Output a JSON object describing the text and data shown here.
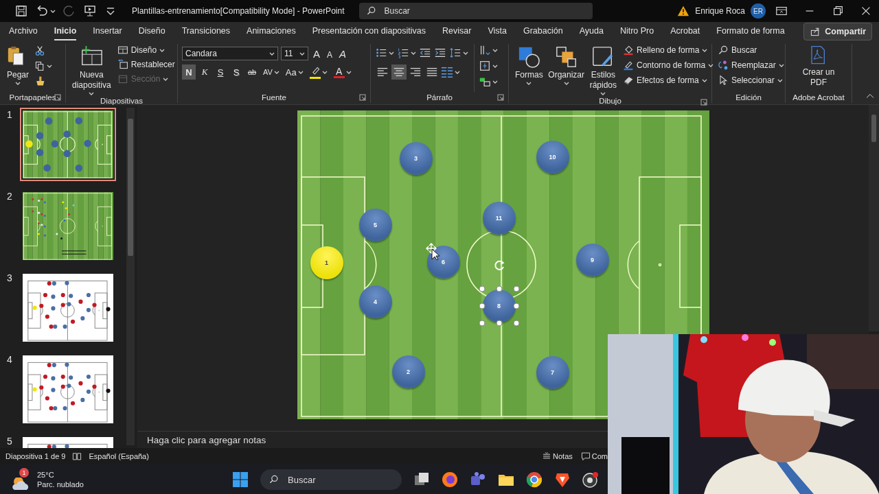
{
  "window": {
    "title": "Plantillas-entrenamiento[Compatibility Mode]  -  PowerPoint",
    "search": {
      "placeholder": "Buscar"
    },
    "user_name": "Enrique Roca",
    "avatar_initials": "ER"
  },
  "tabs": [
    {
      "label": "Archivo",
      "selected": false
    },
    {
      "label": "Inicio",
      "selected": true
    },
    {
      "label": "Insertar",
      "selected": false
    },
    {
      "label": "Diseño",
      "selected": false
    },
    {
      "label": "Transiciones",
      "selected": false
    },
    {
      "label": "Animaciones",
      "selected": false
    },
    {
      "label": "Presentación con diapositivas",
      "selected": false
    },
    {
      "label": "Revisar",
      "selected": false
    },
    {
      "label": "Vista",
      "selected": false
    },
    {
      "label": "Grabación",
      "selected": false
    },
    {
      "label": "Ayuda",
      "selected": false
    },
    {
      "label": "Nitro Pro",
      "selected": false
    },
    {
      "label": "Acrobat",
      "selected": false
    },
    {
      "label": "Formato de forma",
      "selected": false
    }
  ],
  "share_button": "Compartir",
  "ribbon": {
    "clipboard": {
      "label": "Portapapeles",
      "paste": "Pegar"
    },
    "slides": {
      "label": "Diapositivas",
      "new_slide": "Nueva diapositiva",
      "items": [
        {
          "label": "Diseño",
          "disabled": false
        },
        {
          "label": "Restablecer",
          "disabled": false
        },
        {
          "label": "Sección",
          "disabled": true
        }
      ]
    },
    "font": {
      "label": "Fuente",
      "family": "Candara",
      "size": "11",
      "size_buttons": [
        {
          "label": "A",
          "kind": "grow"
        },
        {
          "label": "A",
          "kind": "shrink"
        },
        {
          "label": "A",
          "kind": "clear"
        }
      ],
      "format_buttons": [
        {
          "label": "N",
          "kind": "bold",
          "selected": true
        },
        {
          "label": "K",
          "kind": "italic",
          "selected": false
        },
        {
          "label": "S",
          "kind": "underline",
          "selected": false
        },
        {
          "label": "S",
          "kind": "shadow",
          "selected": false
        },
        {
          "label": "ab",
          "kind": "strike",
          "selected": false
        },
        {
          "label": "AV",
          "kind": "spacing",
          "selected": false
        },
        {
          "label": "Aa",
          "kind": "case",
          "selected": false
        }
      ],
      "color_buttons": [
        {
          "kind": "highlight",
          "color": "#f2e600"
        },
        {
          "kind": "font_color",
          "label": "A",
          "color": "#e0202a"
        }
      ]
    },
    "paragraph": {
      "label": "Párrafo",
      "alignments": [
        {
          "kind": "left",
          "selected": false
        },
        {
          "kind": "center",
          "selected": true
        },
        {
          "kind": "right",
          "selected": false
        },
        {
          "kind": "justify",
          "selected": false
        }
      ]
    },
    "drawing": {
      "label": "Dibujo",
      "big_buttons": [
        "Formas",
        "Organizar",
        "Estilos rápidos"
      ],
      "items": [
        "Relleno de forma",
        "Contorno de forma",
        "Efectos de forma"
      ]
    },
    "editing": {
      "label": "Edición",
      "items": [
        "Buscar",
        "Reemplazar",
        "Seleccionar"
      ]
    },
    "acrobat": {
      "label": "Adobe Acrobat",
      "button": "Crear un PDF"
    }
  },
  "slides": [
    {
      "number": "1",
      "kind": "formation",
      "selected": true
    },
    {
      "number": "2",
      "kind": "props",
      "selected": false
    },
    {
      "number": "3",
      "kind": "tactics",
      "selected": false
    },
    {
      "number": "4",
      "kind": "tactics",
      "selected": false
    },
    {
      "number": "5",
      "kind": "tactics",
      "selected": false
    }
  ],
  "slide": {
    "players": [
      {
        "number": "1",
        "kind": "keeper",
        "selected": false
      },
      {
        "number": "2",
        "kind": "field",
        "selected": false
      },
      {
        "number": "3",
        "kind": "field",
        "selected": false
      },
      {
        "number": "4",
        "kind": "field",
        "selected": false
      },
      {
        "number": "5",
        "kind": "field",
        "selected": false
      },
      {
        "number": "6",
        "kind": "field",
        "selected": false
      },
      {
        "number": "7",
        "kind": "field",
        "selected": false
      },
      {
        "number": "8",
        "kind": "field",
        "selected": true
      },
      {
        "number": "9",
        "kind": "field",
        "selected": false
      },
      {
        "number": "10",
        "kind": "field",
        "selected": false
      },
      {
        "number": "11",
        "kind": "field",
        "selected": false
      }
    ]
  },
  "notes": {
    "placeholder": "Haga clic para agregar notas"
  },
  "status_bar": {
    "slide_position": "Diapositiva 1 de 9",
    "language": "Español (España)",
    "notes_button": "Notas",
    "comments_button": "Com"
  },
  "taskbar": {
    "weather": {
      "badge": "1",
      "temperature": "25°C",
      "condition": "Parc. nublado"
    },
    "search": {
      "placeholder": "Buscar"
    }
  }
}
